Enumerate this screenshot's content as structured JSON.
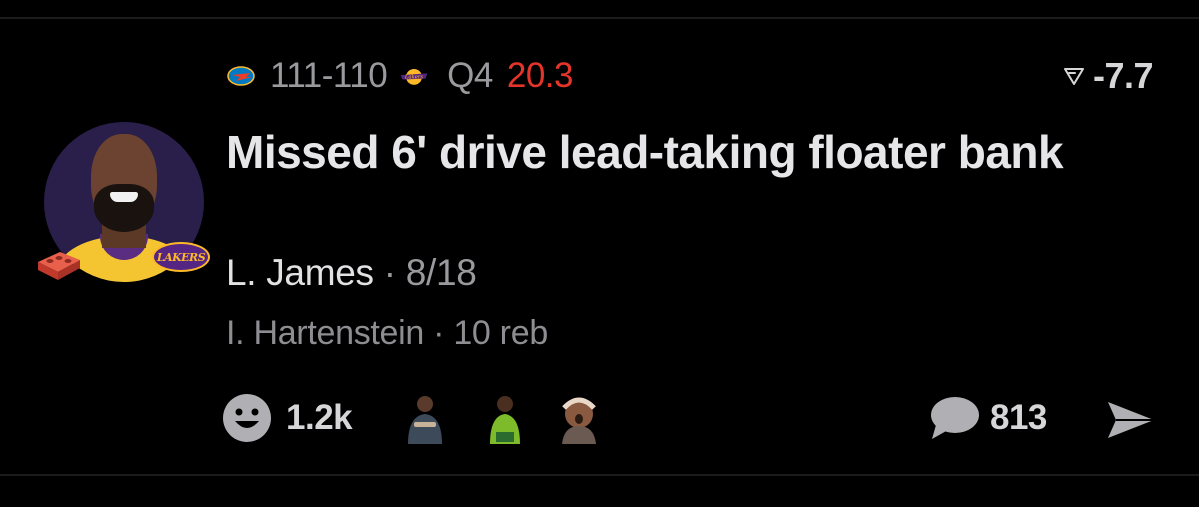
{
  "game": {
    "away_team_icon": "thunder-logo-icon",
    "home_team_icon": "lakers-logo-icon",
    "score": "111-110",
    "quarter": "Q4",
    "clock": "20.3",
    "win_prob_change": "-7.7",
    "win_prob_icon": "win-probability-icon"
  },
  "play": {
    "headline": "Missed 6' drive lead-taking floater bank",
    "player_name": "L. James",
    "separator": "·",
    "player_stat": "8/18",
    "assist_line": "I. Hartenstein · 10 reb",
    "badge_icon": "brick-icon",
    "team_badge_text": "LAKERS"
  },
  "actions": {
    "reaction_icon": "smile-icon",
    "reaction_count": "1.2k",
    "comment_icon": "comment-bubble-icon",
    "comment_count": "813",
    "share_icon": "share-arrow-icon"
  },
  "colors": {
    "background": "#000000",
    "clock_red": "#e5352b",
    "muted_text": "#9a9a9e",
    "primary_text": "#e6e6e8"
  }
}
